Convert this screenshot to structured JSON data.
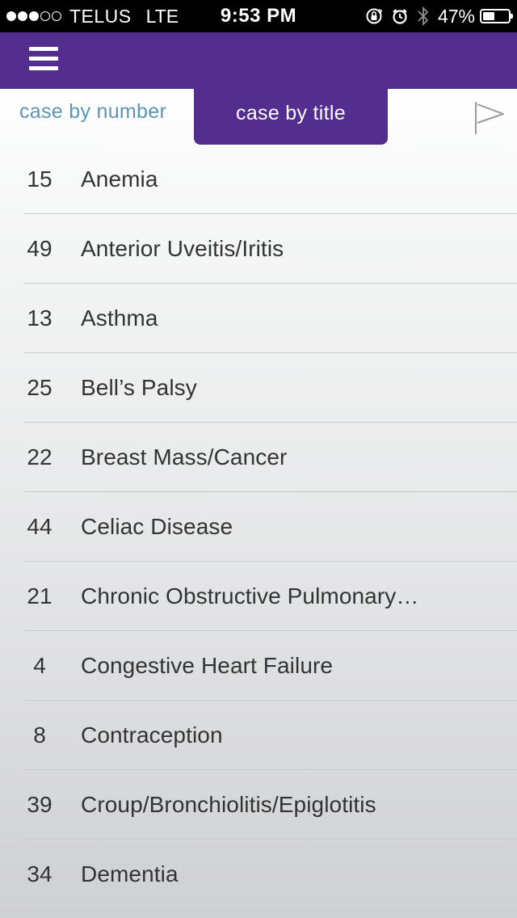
{
  "status_bar": {
    "signal_bars_filled": 3,
    "signal_bars_total": 5,
    "carrier": "TELUS",
    "network": "LTE",
    "time": "9:53 PM",
    "icons": [
      "orientation-lock-icon",
      "alarm-icon",
      "bluetooth-icon"
    ],
    "battery_percent_text": "47%",
    "battery_level": 0.47
  },
  "header": {
    "menu_icon": "hamburger-menu-icon",
    "background_color": "#532e8e"
  },
  "tabs": {
    "by_number_label": "case by number",
    "by_title_label": "case by title",
    "active": "case by title",
    "flag_icon": "flag-icon"
  },
  "cases": [
    {
      "number": "15",
      "title": "Anemia"
    },
    {
      "number": "49",
      "title": "Anterior Uveitis/Iritis"
    },
    {
      "number": "13",
      "title": "Asthma"
    },
    {
      "number": "25",
      "title": "Bell’s Palsy"
    },
    {
      "number": "22",
      "title": "Breast Mass/Cancer"
    },
    {
      "number": "44",
      "title": "Celiac Disease"
    },
    {
      "number": "21",
      "title": "Chronic Obstructive Pulmonary…"
    },
    {
      "number": "4",
      "title": "Congestive Heart Failure"
    },
    {
      "number": "8",
      "title": "Contraception"
    },
    {
      "number": "39",
      "title": "Croup/Bronchiolitis/Epiglotitis"
    },
    {
      "number": "34",
      "title": "Dementia"
    }
  ],
  "colors": {
    "accent": "#532e8e",
    "inactive_tab_text": "#5d96b5",
    "list_text": "#333333"
  }
}
